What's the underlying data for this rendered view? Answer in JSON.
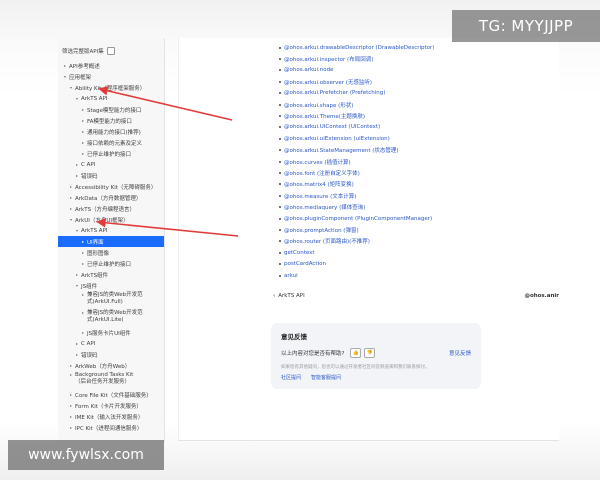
{
  "sidebar": {
    "filter_label": "筛选完整版API集",
    "items": [
      {
        "label": "API参考概述",
        "arrow": "▸",
        "indent": 0
      },
      {
        "label": "应用框架",
        "arrow": "▾",
        "indent": 0
      },
      {
        "label": "Ability Kit（程序框架服务）",
        "arrow": "▾",
        "indent": 1
      },
      {
        "label": "ArkTS API",
        "arrow": "▾",
        "indent": 2
      },
      {
        "label": "Stage模型能力的接口",
        "arrow": "▸",
        "indent": 3
      },
      {
        "label": "FA模型能力的接口",
        "arrow": "▸",
        "indent": 3
      },
      {
        "label": "通用能力的接口(推荐)",
        "arrow": "▸",
        "indent": 3
      },
      {
        "label": "接口依赖的元素及定义",
        "arrow": "▸",
        "indent": 3
      },
      {
        "label": "已停止维护的接口",
        "arrow": "▸",
        "indent": 3
      },
      {
        "label": "C API",
        "arrow": "▸",
        "indent": 2
      },
      {
        "label": "错误码",
        "arrow": "▸",
        "indent": 2
      },
      {
        "label": "Accessibility Kit（无障碍服务）",
        "arrow": "▸",
        "indent": 1
      },
      {
        "label": "ArkData（方舟数据管理）",
        "arrow": "▸",
        "indent": 1
      },
      {
        "label": "ArkTS（方舟编程语言）",
        "arrow": "▸",
        "indent": 1
      },
      {
        "label": "ArkUI（方舟UI框架）",
        "arrow": "▾",
        "indent": 1
      },
      {
        "label": "ArkTS API",
        "arrow": "▾",
        "indent": 2
      },
      {
        "label": "UI界面",
        "arrow": "▸",
        "indent": 3,
        "active": true
      },
      {
        "label": "图形图像",
        "arrow": "▸",
        "indent": 3
      },
      {
        "label": "已停止维护的接口",
        "arrow": "▸",
        "indent": 3
      },
      {
        "label": "ArkTS组件",
        "arrow": "▸",
        "indent": 2
      },
      {
        "label": "JS组件",
        "arrow": "▾",
        "indent": 2
      },
      {
        "label": "兼容JS的类Web开发范式(ArkUI.Full)",
        "arrow": "▸",
        "indent": 3,
        "tall": true
      },
      {
        "label": "兼容JS的类Web开发范式(ArkUI.Lite)",
        "arrow": "▸",
        "indent": 3,
        "tall": true
      },
      {
        "label": "JS服务卡片UI组件",
        "arrow": "▸",
        "indent": 3
      },
      {
        "label": "C API",
        "arrow": "▸",
        "indent": 2
      },
      {
        "label": "错误码",
        "arrow": "▸",
        "indent": 2
      },
      {
        "label": "ArkWeb（方舟Web）",
        "arrow": "▸",
        "indent": 1
      },
      {
        "label": "Background Tasks Kit（后台任务开发服务）",
        "arrow": "▸",
        "indent": 1,
        "tall": true
      },
      {
        "label": "Core File Kit（文件基础服务）",
        "arrow": "▸",
        "indent": 1
      },
      {
        "label": "Form Kit（卡片开发服务）",
        "arrow": "▸",
        "indent": 1
      },
      {
        "label": "IME Kit（输入法开发服务）",
        "arrow": "▸",
        "indent": 1
      },
      {
        "label": "IPC Kit（进程间通信服务）",
        "arrow": "▸",
        "indent": 1
      }
    ]
  },
  "content": {
    "api_items": [
      "@ohos.arkui.drawableDescriptor (DrawableDescriptor)",
      "@ohos.arkui.inspector (布局回调)",
      "@ohos.arkui.node",
      "@ohos.arkui.observer (无感监听)",
      "@ohos.arkui.Prefetcher (Prefetching)",
      "@ohos.arkui.shape (形状)",
      "@ohos.arkui.Theme(主题换肤)",
      "@ohos.arkui.UIContext (UIContext)",
      "@ohos.arkui.uiExtension (uiExtension)",
      "@ohos.arkui.StateManagement (状态管理)",
      "@ohos.curves (插值计算)",
      "@ohos.font (注册自定义字体)",
      "@ohos.matrix4 (矩阵变换)",
      "@ohos.measure (文本计算)",
      "@ohos.mediaquery (媒体查询)",
      "@ohos.pluginComponent (PluginComponentManager)",
      "@ohos.promptAction (弹窗)",
      "@ohos.router (页面路由)(不推荐)",
      "getContext",
      "postCardAction",
      "arkui"
    ],
    "prev_label": "ArkTS API",
    "prev_icon": "chevron-left-icon",
    "next_label": "@ohos.anir"
  },
  "feedback": {
    "title": "意见反馈",
    "question": "以上内容对您是否有帮助?",
    "thumb_up_icon": "thumb-up-icon",
    "thumb_down_icon": "thumb-down-icon",
    "feedback_link": "意见反馈",
    "note": "如果您有其他疑问，您也可以通过开发者社区问答频道来和我们联系探讨。",
    "link_community": "社区提问",
    "link_smart": "智能客服提问"
  },
  "watermarks": {
    "top": "TG: MYYJJPP",
    "bottom": "www.fywlsx.com"
  },
  "colors": {
    "accent": "#1a6bff",
    "link": "#2a56c6",
    "annotation_arrow": "#e23b3b"
  }
}
